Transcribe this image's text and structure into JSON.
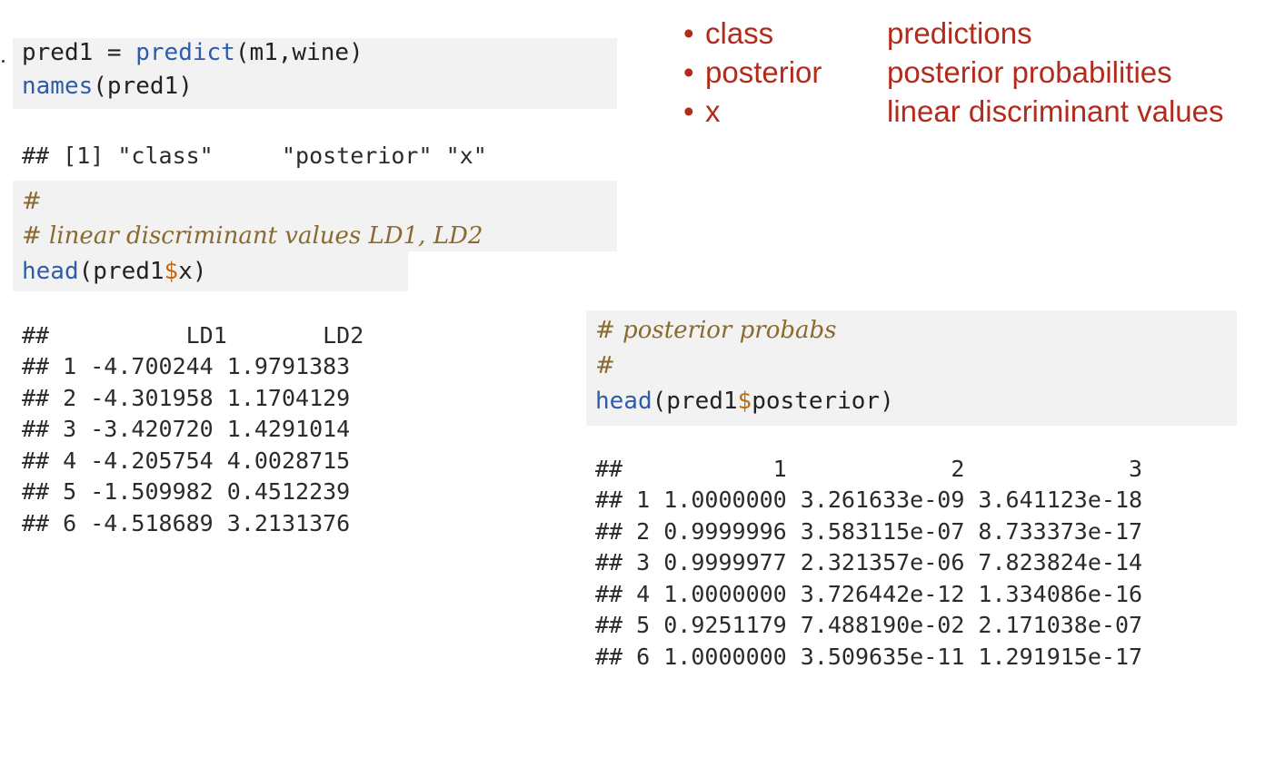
{
  "legend": {
    "items": [
      {
        "bullet": "•",
        "term": "class",
        "desc": "predictions"
      },
      {
        "bullet": "•",
        "term": "posterior",
        "desc": "posterior probabilities"
      },
      {
        "bullet": "•",
        "term": "x",
        "desc": "linear discriminant values"
      }
    ]
  },
  "code1": {
    "line1_var": "pred1 = ",
    "line1_fn": "predict",
    "line1_args": "(m1,wine)",
    "line2_fn": "names",
    "line2_args": "(pred1)"
  },
  "output1": "## [1] \"class\"     \"posterior\" \"x\"",
  "code2": {
    "comment1": "#",
    "comment2": "# linear discriminant values LD1, LD2",
    "fn": "head",
    "arg_pre": "(pred1",
    "dollar": "$",
    "arg_post": "x)"
  },
  "ld_table": {
    "header": "##          LD1       LD2",
    "rows": [
      "## 1 -4.700244 1.9791383",
      "## 2 -4.301958 1.1704129",
      "## 3 -3.420720 1.4291014",
      "## 4 -4.205754 4.0028715",
      "## 5 -1.509982 0.4512239",
      "## 6 -4.518689 3.2131376"
    ]
  },
  "code3": {
    "comment1": "# posterior probabs",
    "comment2": "#",
    "fn": "head",
    "arg_pre": "(pred1",
    "dollar": "$",
    "arg_post": "posterior)"
  },
  "post_table": {
    "header": "##           1            2            3",
    "rows": [
      "## 1 1.0000000 3.261633e-09 3.641123e-18",
      "## 2 0.9999996 3.583115e-07 8.733373e-17",
      "## 3 0.9999977 2.321357e-06 7.823824e-14",
      "## 4 1.0000000 3.726442e-12 1.334086e-16",
      "## 5 0.9251179 7.488190e-02 2.171038e-07",
      "## 6 1.0000000 3.509635e-11 1.291915e-17"
    ]
  },
  "colors": {
    "legend_red": "#b22b1d",
    "keyword_blue": "#2f5ca8",
    "dollar_orange": "#bf6a10",
    "comment_brown": "#8a6a2e",
    "code_bg": "#f2f2f2"
  }
}
